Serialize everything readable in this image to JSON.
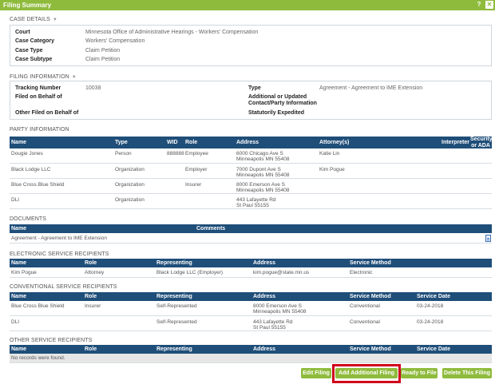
{
  "window": {
    "title": "Filing Summary",
    "help_icon": "?",
    "close_icon": "close-icon"
  },
  "case_details": {
    "title": "CASE DETAILS",
    "rows": [
      {
        "label": "Court",
        "value": "Minnesota Office of Administrative Hearings - Workers' Compensation"
      },
      {
        "label": "Case Category",
        "value": "Workers' Compensation"
      },
      {
        "label": "Case Type",
        "value": "Claim Petition"
      },
      {
        "label": "Case Subtype",
        "value": "Claim Petition"
      }
    ]
  },
  "filing_information": {
    "title": "FILING INFORMATION",
    "tracking_label": "Tracking Number",
    "tracking_value": "10038",
    "filed_on_behalf_label": "Filed on Behalf of",
    "other_filed_label": "Other Filed on Behalf of",
    "type_label": "Type",
    "type_value": "Agreement - Agreement to IME Extension",
    "additional_label": "Additional or Updated Contact/Party Information",
    "expedited_label": "Statutorily Expedited"
  },
  "party_information": {
    "title": "PARTY INFORMATION",
    "headers": [
      "Name",
      "Type",
      "WID",
      "Role",
      "Address",
      "Attorney(s)",
      "Interpreter",
      "Security or ADA"
    ],
    "rows": [
      {
        "name": "Dougie Jones",
        "type": "Person",
        "wid": "888888",
        "role": "Employee",
        "address1": "6000 Chicago Ave S",
        "address2": "Minneapolis MN 55408",
        "attorney": "Katie Lin"
      },
      {
        "name": "Black Lodge LLC",
        "type": "Organization",
        "wid": "",
        "role": "Employer",
        "address1": "7000 Dupont Ave S",
        "address2": "Minneapolis MN 55408",
        "attorney": "Kim Pogue"
      },
      {
        "name": "Blue Cross Blue Shield",
        "type": "Organization",
        "wid": "",
        "role": "Insurer",
        "address1": "8000 Emerson Ave S",
        "address2": "Minneapolis MN 55408",
        "attorney": ""
      },
      {
        "name": "DLI",
        "type": "Organization",
        "wid": "",
        "role": "",
        "address1": "443 Lafayette Rd",
        "address2": "St Paul 55155",
        "attorney": ""
      }
    ]
  },
  "documents": {
    "title": "DOCUMENTS",
    "headers": [
      "Name",
      "Comments"
    ],
    "rows": [
      {
        "name": "Agreement - Agreement to IME Extension",
        "icon": "document-icon"
      }
    ]
  },
  "electronic_service": {
    "title": "ELECTRONIC SERVICE RECIPIENTS",
    "headers": [
      "Name",
      "Role",
      "Representing",
      "Address",
      "Service Method"
    ],
    "rows": [
      {
        "name": "Kim Pogue",
        "role": "Attorney",
        "representing": "Black Lodge LLC (Employer)",
        "address": "kim.pogue@state.mn.us",
        "method": "Electronic"
      }
    ]
  },
  "conventional_service": {
    "title": "CONVENTIONAL SERVICE RECIPIENTS",
    "headers": [
      "Name",
      "Role",
      "Representing",
      "Address",
      "Service Method",
      "Service Date"
    ],
    "rows": [
      {
        "name": "Blue Cross Blue Shield",
        "role": "Insurer",
        "representing": "Self-Represented",
        "address1": "8000 Emerson Ave S",
        "address2": "Minneapolis MN 55408",
        "method": "Conventional",
        "date": "03-24-2018"
      },
      {
        "name": "DLI",
        "role": "",
        "representing": "Self-Represented",
        "address1": "443 Lafayette Rd",
        "address2": "St Paul 55155",
        "method": "Conventional",
        "date": "03-24-2018"
      }
    ]
  },
  "other_service": {
    "title": "OTHER SERVICE RECIPIENTS",
    "headers": [
      "Name",
      "Role",
      "Representing",
      "Address",
      "Service Method",
      "Service Date"
    ],
    "empty_text": "No records were found."
  },
  "actions": {
    "edit_filing": "Edit Filing",
    "add_additional_filing": "Add Additional Filing",
    "ready_to_file": "Ready to File",
    "delete_this_filing": "Delete This Filing"
  },
  "colors": {
    "accent_green": "#8fbb3d",
    "header_blue": "#1f4e79",
    "highlight_red": "#d0021b"
  }
}
